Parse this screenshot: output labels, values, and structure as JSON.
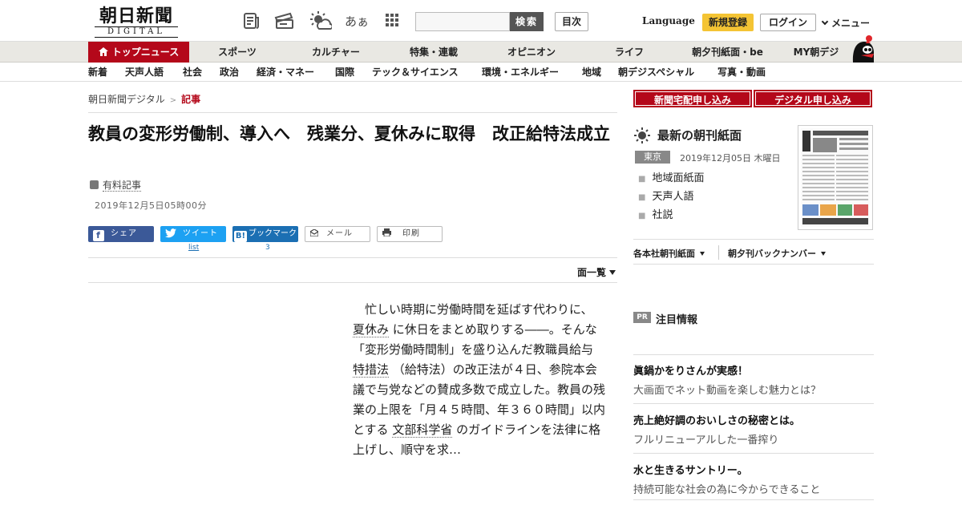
{
  "header": {
    "logo_jp": "朝日新聞",
    "logo_en": "DIGITAL",
    "icons": [
      "newspaper-icon",
      "ticket-icon",
      "weather-icon",
      "font-size-icon",
      "grid-menu-icon"
    ],
    "font_size_label": "あぁ",
    "search_button": "検索",
    "contents_button": "目次",
    "language": "Language",
    "register": "新規登録",
    "login": "ログイン",
    "menu": "メニュー"
  },
  "nav_primary": [
    "トップニュース",
    "スポーツ",
    "カルチャー",
    "特集・連載",
    "オピニオン",
    "ライフ",
    "朝夕刊紙面・be",
    "MY朝デジ"
  ],
  "nav_secondary": [
    "新着",
    "天声人語",
    "社会",
    "政治",
    "経済・マネー",
    "国際",
    "テック＆サイエンス",
    "環境・エネルギー",
    "地域",
    "朝デジスペシャル",
    "写真・動画"
  ],
  "breadcrumb": {
    "home": "朝日新聞デジタル",
    "current": "記事"
  },
  "article": {
    "title": "教員の変形労働制、導入へ　残業分、夏休みに取得　改正給特法成立",
    "paid_label": "有料記事",
    "date": "2019年12月5日05時00分",
    "share": {
      "facebook": "シェア",
      "twitter": "ツイート",
      "twitter_count": "list",
      "hatena": "ブックマーク",
      "hatena_count": "3",
      "mail": "メール",
      "print": "印刷"
    },
    "page_list": "面一覧",
    "body": {
      "p1": "　忙しい時期に労働時間を延ばす代わりに、",
      "l1": "夏休み",
      "p2": "に休日をまとめ取りする――。そんな「変形労働時間制」を盛り込んだ教職員給与",
      "l2": "特措法",
      "p3": "（給特法）の改正法が４日、参院本会議で与党などの賛成多数で成立した。教員の残業の上限を「月４５時間、年３６０時間」以内とする",
      "l3": "文部科学省",
      "p4": "のガイドラインを法律に格上げし、順守を求…"
    }
  },
  "sidebar": {
    "subscribe_paper": "新聞宅配申し込み",
    "subscribe_digital": "デジタル申し込み",
    "paper_title": "最新の朝刊紙面",
    "region": "東京",
    "paper_date": "2019年12月05日 木曜日",
    "paper_links": [
      "地域面紙面",
      "天声人語",
      "社説"
    ],
    "dropdowns": [
      "各本社朝刊紙面",
      "朝夕刊バックナンバー"
    ],
    "pr_badge": "PR",
    "pr_title": "注目情報",
    "ads": [
      {
        "headline": "眞鍋かをりさんが実感！",
        "sub": "大画面でネット動画を楽しむ魅力とは？"
      },
      {
        "headline": "売上絶好調のおいしさの秘密とは。",
        "sub": "フルリニューアルした一番搾り"
      },
      {
        "headline": "水と生きるサントリー。",
        "sub": "持続可能な社会の為に今からできること"
      }
    ]
  },
  "colors": {
    "brand_red": "#b4081a",
    "register_yellow": "#f4c434",
    "facebook": "#3b5998",
    "twitter": "#1da1f2",
    "hatena": "#1b6fb3"
  }
}
